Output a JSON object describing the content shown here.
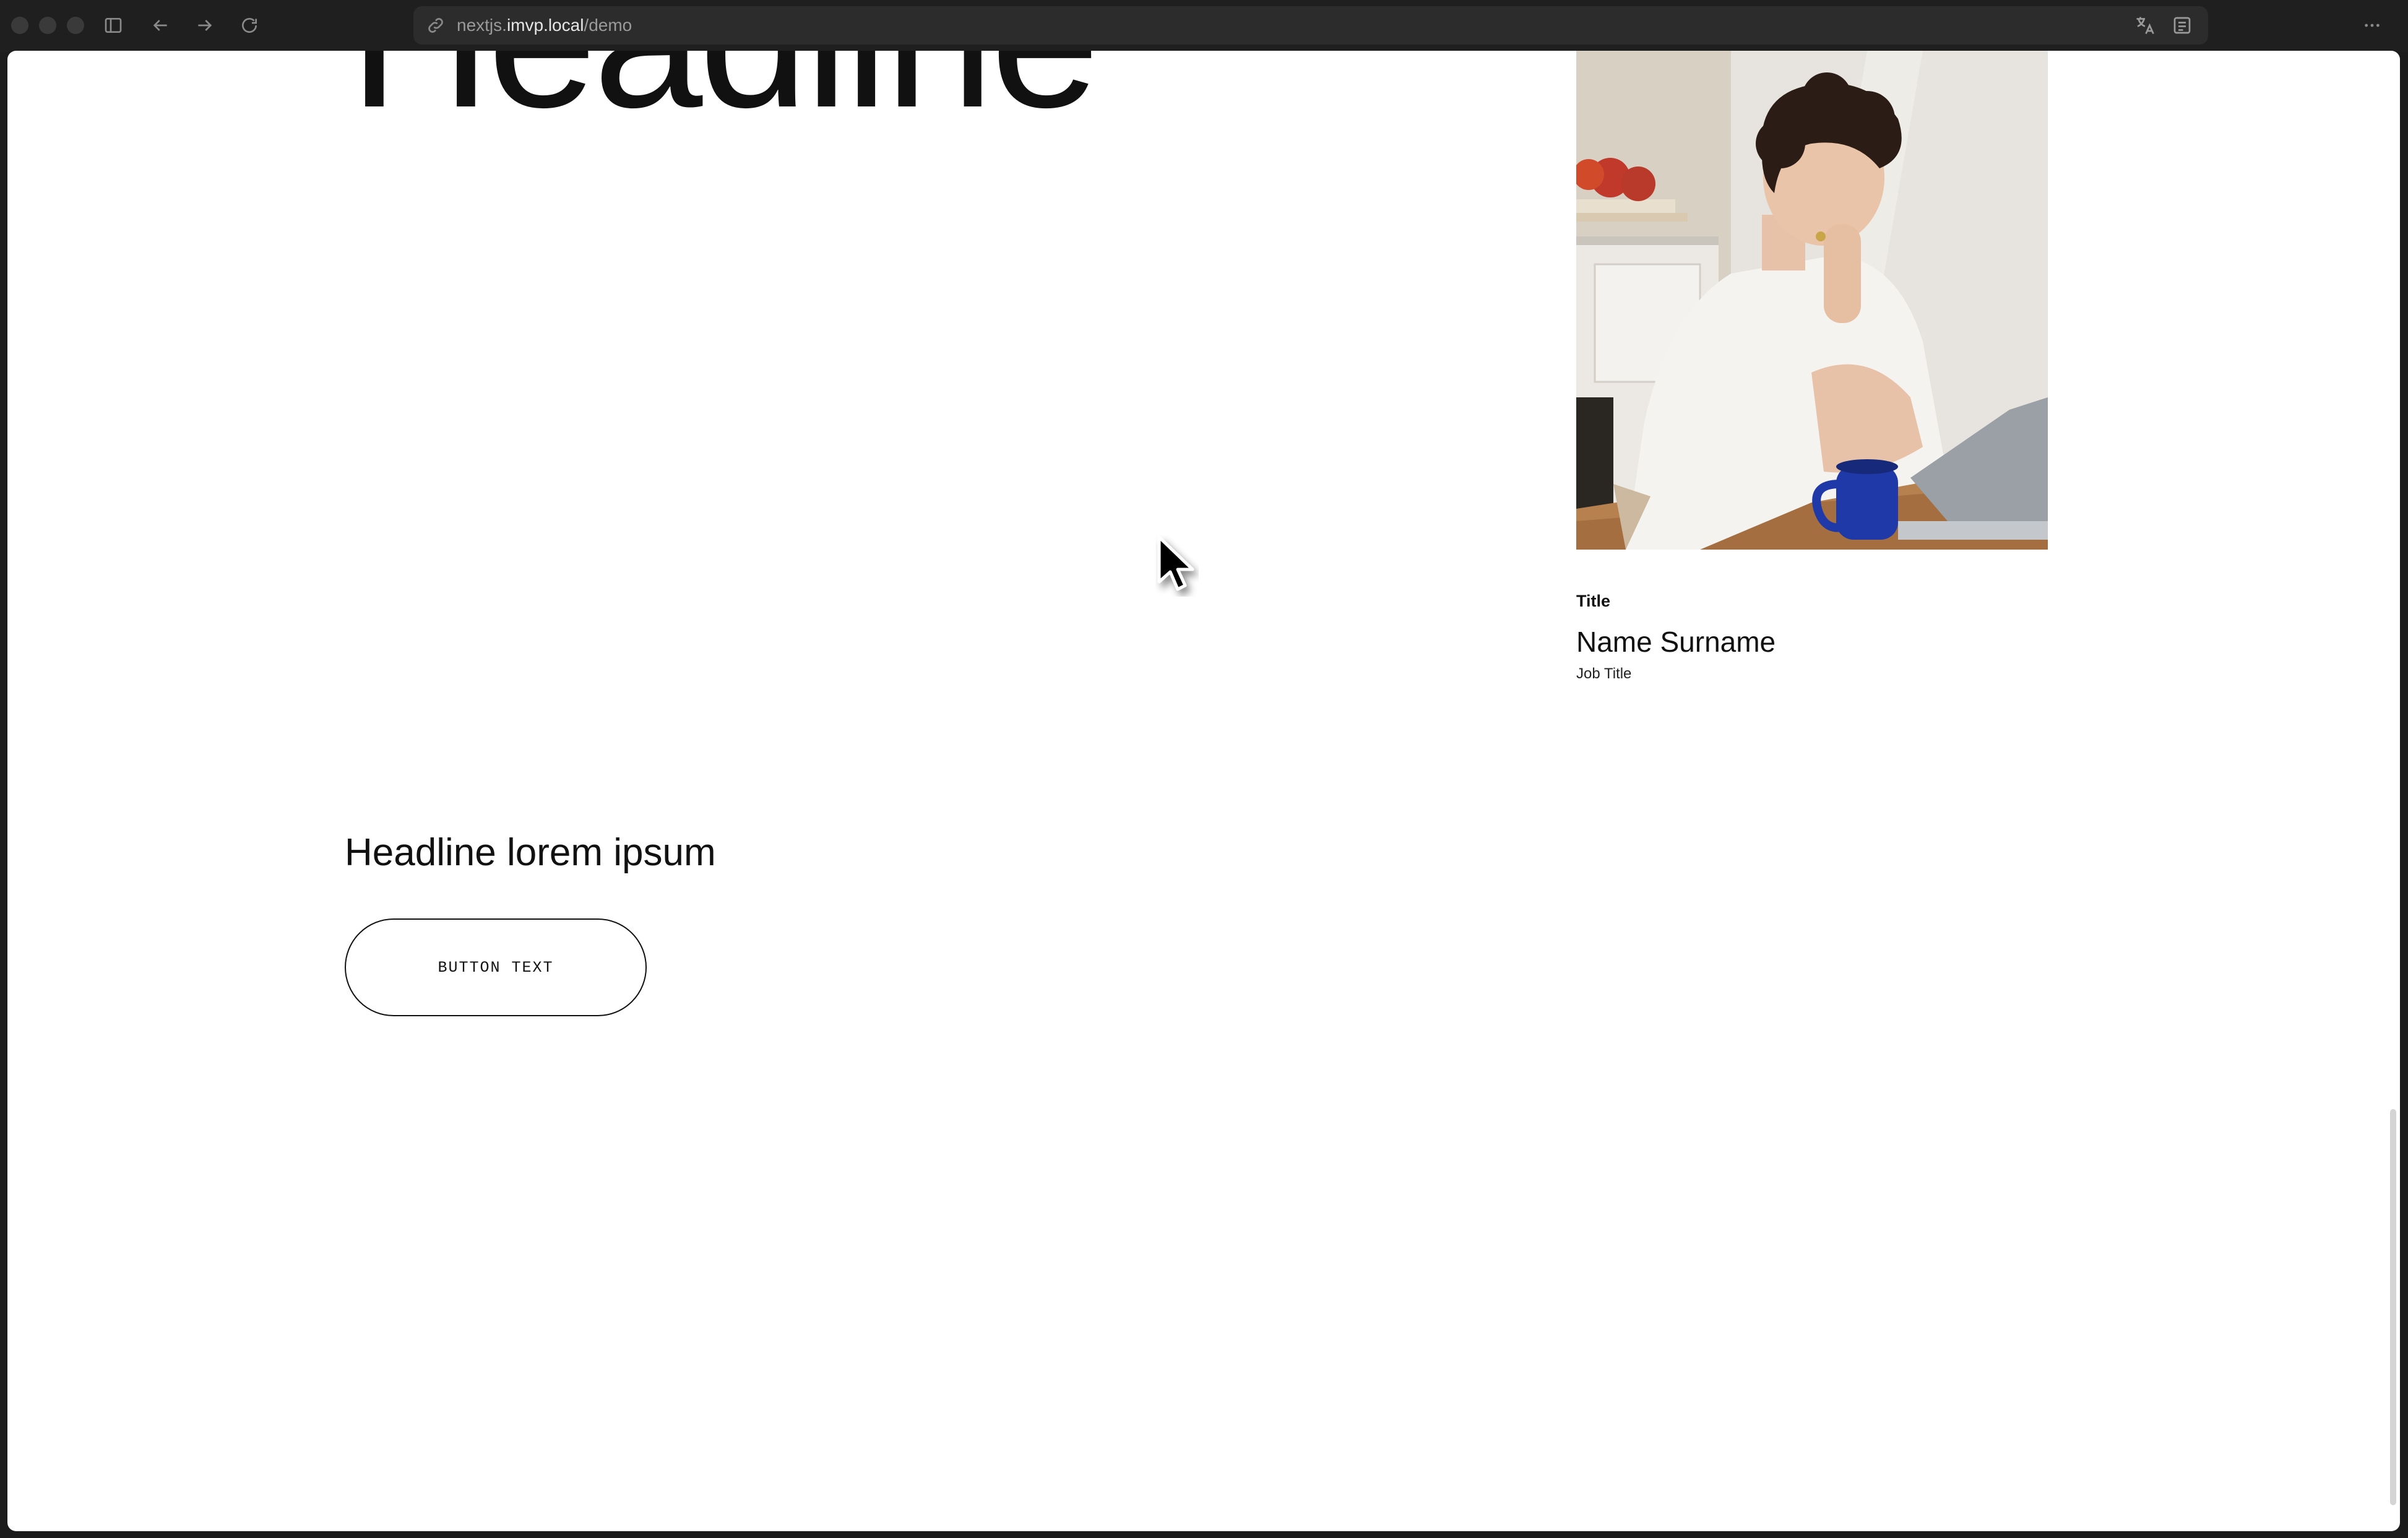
{
  "browser": {
    "url_prefix": "nextjs.",
    "url_host": "imvp.local",
    "url_path": "/demo"
  },
  "hero": {
    "headline": "Headline"
  },
  "profile_card": {
    "eyebrow": "Title",
    "name": "Name Surname",
    "job_title": "Job Title"
  },
  "section": {
    "headline": "Headline lorem ipsum",
    "button_label": "BUTTON TEXT"
  },
  "icons": [
    "sidebar-toggle-icon",
    "back-arrow-icon",
    "forward-arrow-icon",
    "reload-icon",
    "link-icon",
    "translate-icon",
    "reader-icon",
    "more-icon",
    "mouse-cursor-icon"
  ]
}
